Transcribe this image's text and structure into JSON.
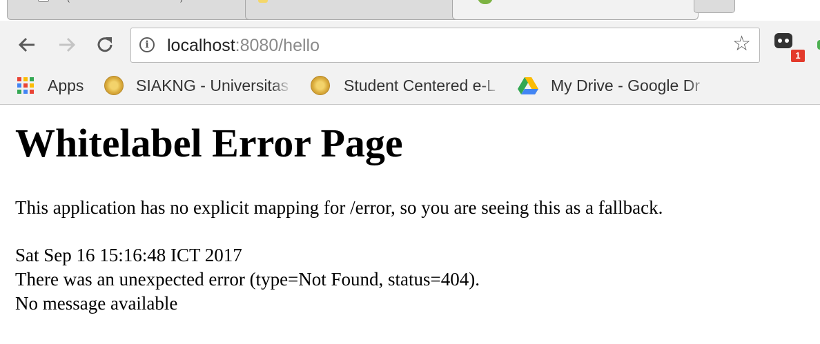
{
  "browser": {
    "tabs": [
      {
        "label": "(",
        "label_tail": ")",
        "active": false
      },
      {
        "label": "",
        "active": false
      },
      {
        "label": "",
        "active": true
      },
      {
        "label": "",
        "active": false
      }
    ],
    "address_bar": {
      "host": "localhost",
      "rest": ":8080/hello"
    },
    "extension_badge": "1",
    "bookmarks": [
      {
        "label": "Apps",
        "icon": "apps-grid-icon"
      },
      {
        "label": "SIAKNG - Universitas",
        "icon": "university-seal-icon"
      },
      {
        "label": "Student Centered e-L",
        "icon": "university-seal-icon"
      },
      {
        "label": "My Drive - Google Dr",
        "icon": "google-drive-icon"
      }
    ]
  },
  "page": {
    "title": "Whitelabel Error Page",
    "message": "This application has no explicit mapping for /error, so you are seeing this as a fallback.",
    "timestamp": "Sat Sep 16 15:16:48 ICT 2017",
    "error_line": "There was an unexpected error (type=Not Found, status=404).",
    "detail_line": "No message available"
  },
  "colors": {
    "chrome_bg": "#f2f2f2",
    "badge_red": "#e33a2c",
    "url_gray": "#8a8a8a"
  }
}
